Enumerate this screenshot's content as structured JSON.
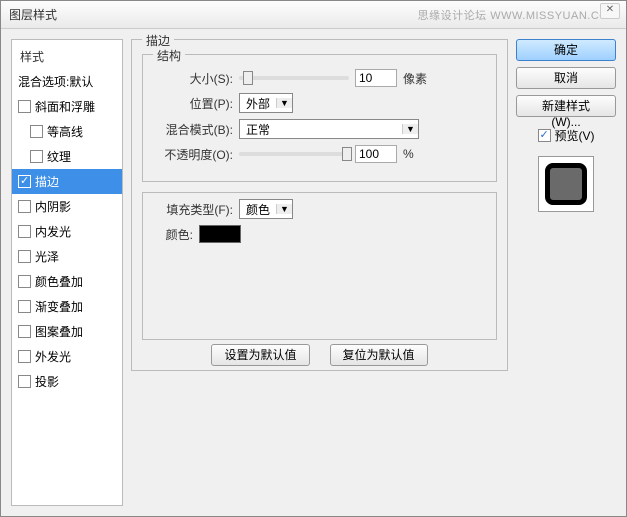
{
  "window": {
    "title": "图层样式",
    "watermark": "思缘设计论坛  WWW.MISSYUAN.COM"
  },
  "sidebar": {
    "header": "样式",
    "blend_default": "混合选项:默认",
    "items": [
      {
        "label": "斜面和浮雕",
        "checked": false,
        "indent": false
      },
      {
        "label": "等高线",
        "checked": false,
        "indent": true
      },
      {
        "label": "纹理",
        "checked": false,
        "indent": true
      },
      {
        "label": "描边",
        "checked": true,
        "indent": false,
        "selected": true
      },
      {
        "label": "内阴影",
        "checked": false,
        "indent": false
      },
      {
        "label": "内发光",
        "checked": false,
        "indent": false
      },
      {
        "label": "光泽",
        "checked": false,
        "indent": false
      },
      {
        "label": "颜色叠加",
        "checked": false,
        "indent": false
      },
      {
        "label": "渐变叠加",
        "checked": false,
        "indent": false
      },
      {
        "label": "图案叠加",
        "checked": false,
        "indent": false
      },
      {
        "label": "外发光",
        "checked": false,
        "indent": false
      },
      {
        "label": "投影",
        "checked": false,
        "indent": false
      }
    ]
  },
  "structure": {
    "legend_outer": "描边",
    "legend_inner": "结构",
    "size_label": "大小(S):",
    "size_value": "10",
    "size_unit": "像素",
    "position_label": "位置(P):",
    "position_value": "外部",
    "blend_label": "混合模式(B):",
    "blend_value": "正常",
    "opacity_label": "不透明度(O):",
    "opacity_value": "100",
    "opacity_unit": "%"
  },
  "fill": {
    "type_label": "填充类型(F):",
    "type_value": "颜色",
    "color_label": "颜色:",
    "color_value": "#000000"
  },
  "footer": {
    "set_default": "设置为默认值",
    "reset_default": "复位为默认值"
  },
  "right": {
    "ok": "确定",
    "cancel": "取消",
    "new_style": "新建样式(W)...",
    "preview_label": "预览(V)"
  }
}
